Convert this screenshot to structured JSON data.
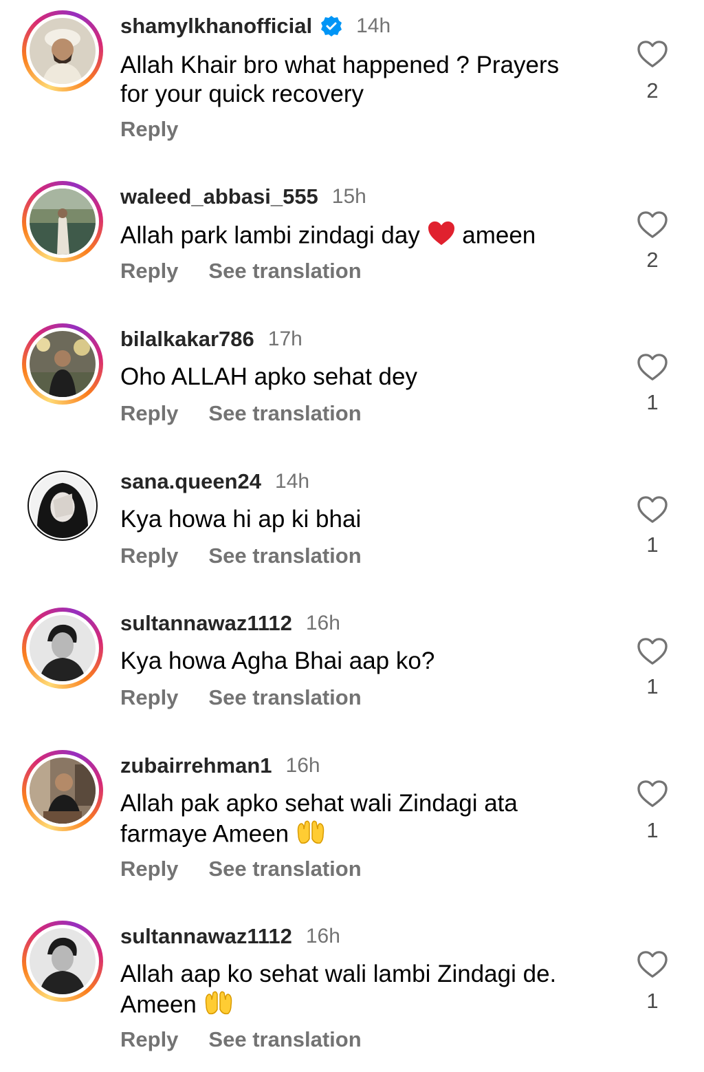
{
  "comments": [
    {
      "username": "shamylkhanofficial",
      "verified": true,
      "time": "14h",
      "text_lines": [
        "Allah Khair bro what happened ? Prayers",
        "for your quick recovery"
      ],
      "reply": "Reply",
      "see_translation": "",
      "likes": "2"
    },
    {
      "username": "waleed_abbasi_555",
      "verified": false,
      "time": "15h",
      "text_parts": [
        "Allah park lambi  zindagi  day ",
        "red-heart-emoji",
        " ameen"
      ],
      "reply": "Reply",
      "see_translation": "See translation",
      "likes": "2"
    },
    {
      "username": "bilalkakar786",
      "verified": false,
      "time": "17h",
      "text_lines": [
        "Oho ALLAH apko sehat dey"
      ],
      "reply": "Reply",
      "see_translation": "See translation",
      "likes": "1"
    },
    {
      "username": "sana.queen24",
      "verified": false,
      "time": "14h",
      "text_lines": [
        "Kya howa hi ap ki bhai"
      ],
      "reply": "Reply",
      "see_translation": "See translation",
      "likes": "1"
    },
    {
      "username": "sultannawaz1112",
      "verified": false,
      "time": "16h",
      "text_lines": [
        "Kya howa Agha Bhai aap ko?"
      ],
      "reply": "Reply",
      "see_translation": "See translation",
      "likes": "1"
    },
    {
      "username": "zubairrehman1",
      "verified": false,
      "time": "16h",
      "text_lines": [
        "Allah pak apko sehat wali Zindagi ata",
        "farmaye Ameen "
      ],
      "trailing_emoji": "palms-up-emoji",
      "reply": "Reply",
      "see_translation": "See translation",
      "likes": "1"
    },
    {
      "username": "sultannawaz1112",
      "verified": false,
      "time": "16h",
      "text_lines": [
        "Allah aap ko sehat wali lambi Zindagi de.",
        "Ameen "
      ],
      "trailing_emoji": "palms-up-emoji",
      "reply": "Reply",
      "see_translation": "See translation",
      "likes": "1"
    }
  ],
  "icons": {
    "like": "heart-outline-icon",
    "verified": "verified-badge-icon"
  },
  "colors": {
    "username": "#262626",
    "secondary": "#737373",
    "verified": "#0095f6"
  }
}
